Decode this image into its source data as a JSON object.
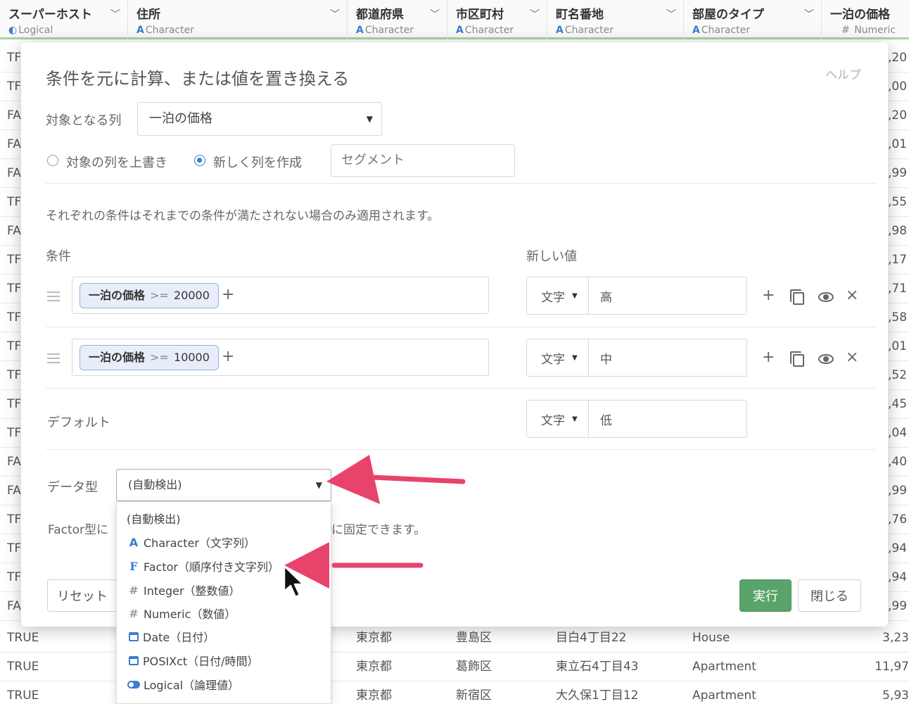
{
  "table": {
    "columns": [
      {
        "name": "スーパーホスト",
        "type": "Logical",
        "type_icon": "toggle-icon"
      },
      {
        "name": "住所",
        "type": "Character",
        "type_icon": "A"
      },
      {
        "name": "都道府県",
        "type": "Character",
        "type_icon": "A"
      },
      {
        "name": "市区町村",
        "type": "Character",
        "type_icon": "A"
      },
      {
        "name": "町名番地",
        "type": "Character",
        "type_icon": "A"
      },
      {
        "name": "部屋のタイプ",
        "type": "Character",
        "type_icon": "A"
      },
      {
        "name": "一泊の価格",
        "type": "Numeric",
        "type_icon": "#"
      }
    ],
    "partial_rows": [
      {
        "first": "TF",
        "last": ",20"
      },
      {
        "first": "TF",
        "last": ",00"
      },
      {
        "first": "FA",
        "last": ",20"
      },
      {
        "first": "FA",
        "last": ",01"
      },
      {
        "first": "FA",
        "last": ",99"
      },
      {
        "first": "TF",
        "last": ",55"
      },
      {
        "first": "FA",
        "last": ",98"
      },
      {
        "first": "TF",
        "last": ",17"
      },
      {
        "first": "TF",
        "last": ",71"
      },
      {
        "first": "TF",
        "last": ",58"
      },
      {
        "first": "TF",
        "last": ",01"
      },
      {
        "first": "TF",
        "last": ",52"
      },
      {
        "first": "TF",
        "last": ",45"
      },
      {
        "first": "TF",
        "last": ",04"
      },
      {
        "first": "FA",
        "last": ",40"
      },
      {
        "first": "FA",
        "last": ",99"
      },
      {
        "first": "TF",
        "last": ",76"
      },
      {
        "first": "TF",
        "last": ",94"
      },
      {
        "first": "TF",
        "last": ",94"
      },
      {
        "first": "FA",
        "last": ",99"
      }
    ],
    "full_rows": [
      {
        "superhost": "TRUE",
        "pref": "東京都",
        "city": "豊島区",
        "street": "目白4丁目22",
        "room": "House",
        "price": "3,23"
      },
      {
        "superhost": "TRUE",
        "pref": "東京都",
        "city": "葛飾区",
        "street": "東立石4丁目43",
        "room": "Apartment",
        "price": "11,97"
      },
      {
        "superhost": "TRUE",
        "pref": "東京都",
        "city": "新宿区",
        "street": "大久保1丁目12",
        "room": "Apartment",
        "price": "5,93"
      }
    ]
  },
  "modal": {
    "title": "条件を元に計算、または値を置き換える",
    "help": "ヘルプ",
    "target_label": "対象となる列",
    "target_value": "一泊の価格",
    "radio_overwrite": "対象の列を上書き",
    "radio_new": "新しく列を作成",
    "new_column_name": "セグメント",
    "info": "それぞれの条件はそれまでの条件が満たされない場合のみ適用されます。",
    "conditions_header": "条件",
    "new_value_header": "新しい値",
    "conditions": [
      {
        "column": "一泊の価格",
        "operator": ">=",
        "value": "20000",
        "value_type": "文字",
        "new_value": "高"
      },
      {
        "column": "一泊の価格",
        "operator": ">=",
        "value": "10000",
        "value_type": "文字",
        "new_value": "中"
      }
    ],
    "default_label": "デフォルト",
    "default_type": "文字",
    "default_value": "低",
    "datatype_label": "データ型",
    "datatype_value": "(自動検出)",
    "factor_note_start": "Factor型に",
    "factor_note_end": "に固定できます。",
    "reset_button": "リセット",
    "run_button": "実行",
    "close_button": "閉じる",
    "plus_symbol": "+",
    "close_symbol": "×"
  },
  "dropdown": {
    "options": [
      {
        "label": "(自動検出)",
        "icon": ""
      },
      {
        "label": "Character（文字列）",
        "icon": "A"
      },
      {
        "label": "Factor（順序付き文字列）",
        "icon": "F"
      },
      {
        "label": "Integer（整数値）",
        "icon": "#"
      },
      {
        "label": "Numeric（数値）",
        "icon": "#"
      },
      {
        "label": "Date（日付）",
        "icon": "calendar-icon"
      },
      {
        "label": "POSIXct（日付/時間）",
        "icon": "calendar-icon"
      },
      {
        "label": "Logical（論理値）",
        "icon": "toggle-icon"
      }
    ]
  },
  "colors": {
    "accent_blue": "#3d7bd0",
    "run_green": "#5aa36a",
    "arrow_pink": "#e8436b"
  }
}
